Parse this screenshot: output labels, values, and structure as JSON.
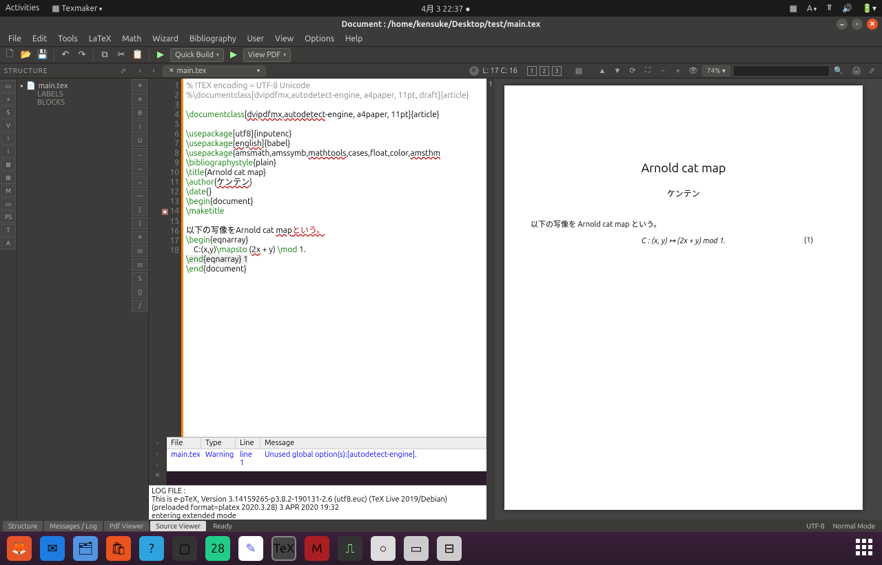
{
  "topbar": {
    "activities": "Activities",
    "appname": "Texmaker",
    "datetime": "4月 3 22:37",
    "a_label": "A"
  },
  "title": "Document : /home/kensuke/Desktop/test/main.tex",
  "menu": [
    "File",
    "Edit",
    "Tools",
    "LaTeX",
    "Math",
    "Wizard",
    "Bibliography",
    "User",
    "View",
    "Options",
    "Help"
  ],
  "toolbar": {
    "quickbuild": "Quick Build",
    "viewpdf": "View PDF"
  },
  "structure_label": "STRUCTURE",
  "structure": {
    "file": "main.tex",
    "labels": "LABELS",
    "blocks": "BLOCKS"
  },
  "tab": {
    "file": "main.tex",
    "pos": "L: 17 C: 16"
  },
  "pdfbar": {
    "p1": "1",
    "p2": "2",
    "p3": "3",
    "zoom": "74%"
  },
  "gutter": [
    "1",
    "2",
    "",
    "3",
    "",
    "4",
    "5",
    "6",
    "7",
    "8",
    "9",
    "10",
    "11",
    "12",
    "13",
    "14",
    "15",
    "16",
    "17",
    "18"
  ],
  "code": {
    "l1": "% !TEX encoding = UTF-8 Unicode",
    "l2": "%\\documentclass[dvipdfmx,autodetect-engine, a4paper, 11pt, draft]{article}",
    "l3a": "\\documentclass",
    "l3b": "[",
    "l3c": "dvipdfmx",
    "l3d": ",",
    "l3e": "autodetect",
    "l3f": "-engine, a4paper, 11pt]{article}",
    "l4a": "\\usepackage",
    "l4b": "[utf8]{inputenc}",
    "l5a": "\\usepackage",
    "l5b": "[",
    "l5c": "english",
    "l5d": "]{babel}",
    "l6a": "\\usepackage",
    "l6b": "{amsmath,amssymb,",
    "l6c": "mathtools",
    "l6d": ",cases,float,color,",
    "l6e": "amsthm",
    "l7a": "\\bibliographystyle",
    "l7b": "{plain}",
    "l8a": "\\title",
    "l8b": "{Arnold cat map}",
    "l9a": "\\author",
    "l9b": "{",
    "l9c": "ケンテン",
    "l9d": "}",
    "l10a": "\\date",
    "l10b": "{}",
    "l11a": "\\begin",
    "l11b": "{document}",
    "l12": "\\maketitle",
    "l14a": "以下の写像をArnold cat ",
    "l14b": "map",
    "l14c": "という。",
    "l15a": "\\begin",
    "l15b": "{eqnarray}",
    "l16a": "    C:(x,y)",
    "l16b": "\\mapsto",
    "l16c": " (",
    "l16d": "2x",
    "l16e": " + y) ",
    "l16f": "\\mod",
    "l16g": " 1.",
    "l17a": "\\end",
    "l17b": "{eqnarray}",
    "l17c": " 1",
    "l18a": "\\end",
    "l18b": "{document}"
  },
  "messages": {
    "hdr": {
      "file": "File",
      "type": "Type",
      "line": "Line",
      "msg": "Message"
    },
    "row": {
      "file": "main.tex",
      "type": "Warning",
      "line": "line 1",
      "msg": "Unused global option(s):[autodetect-engine]."
    }
  },
  "log": {
    "l1": "LOG FILE :",
    "l2": "This is e-pTeX, Version 3.14159265-p3.8.2-190131-2.6 (utf8.euc) (TeX Live 2019/Debian)",
    "l3": "(preloaded format=platex 2020.3.28)  3 APR 2020 19:32",
    "l4": "entering extended mode"
  },
  "pdf": {
    "title": "Arnold cat map",
    "author": "ケンテン",
    "body": "以下の写像を Arnold cat map という。",
    "eq": "C : (x, y) ↦ (2x + y)    mod 1.",
    "eqnum": "(1)",
    "pagecol": "1"
  },
  "tabs": {
    "t1": "Structure",
    "t2": "Messages / Log",
    "t3": "Pdf Viewer",
    "t4": "Source Viewer",
    "status": "Ready",
    "enc": "UTF-8",
    "mode": "Normal Mode"
  }
}
